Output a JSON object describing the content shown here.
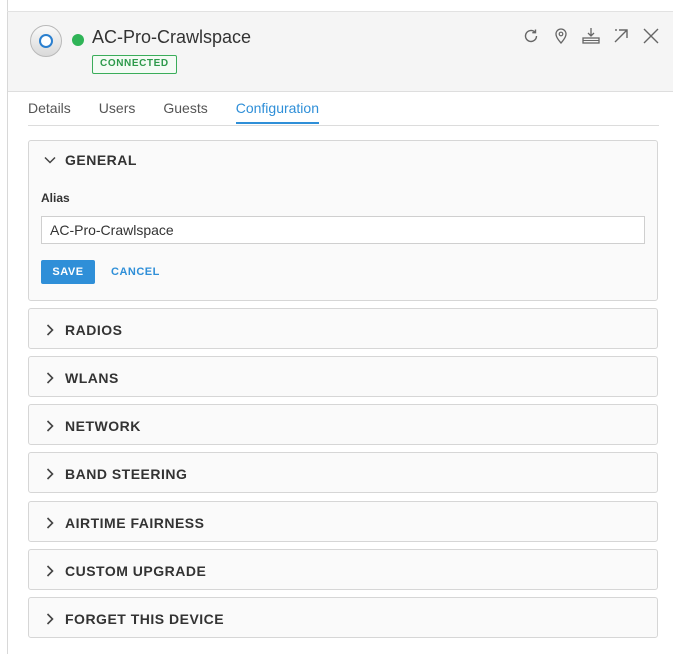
{
  "device": {
    "name": "AC-Pro-Crawlspace",
    "status_badge": "CONNECTED",
    "status_color": "#2fb457"
  },
  "header_actions": [
    "refresh-icon",
    "locate-icon",
    "upgrade-icon",
    "popout-icon",
    "close-icon"
  ],
  "tabs": [
    {
      "label": "Details",
      "active": false
    },
    {
      "label": "Users",
      "active": false
    },
    {
      "label": "Guests",
      "active": false
    },
    {
      "label": "Configuration",
      "active": true
    }
  ],
  "general": {
    "title": "GENERAL",
    "alias_label": "Alias",
    "alias_value": "AC-Pro-Crawlspace",
    "save_label": "SAVE",
    "cancel_label": "CANCEL"
  },
  "sections": [
    "RADIOS",
    "WLANS",
    "NETWORK",
    "BAND STEERING",
    "AIRTIME FAIRNESS",
    "CUSTOM UPGRADE",
    "FORGET THIS DEVICE"
  ],
  "colors": {
    "accent": "#2f8fd8",
    "connected": "#2d9a4b"
  }
}
